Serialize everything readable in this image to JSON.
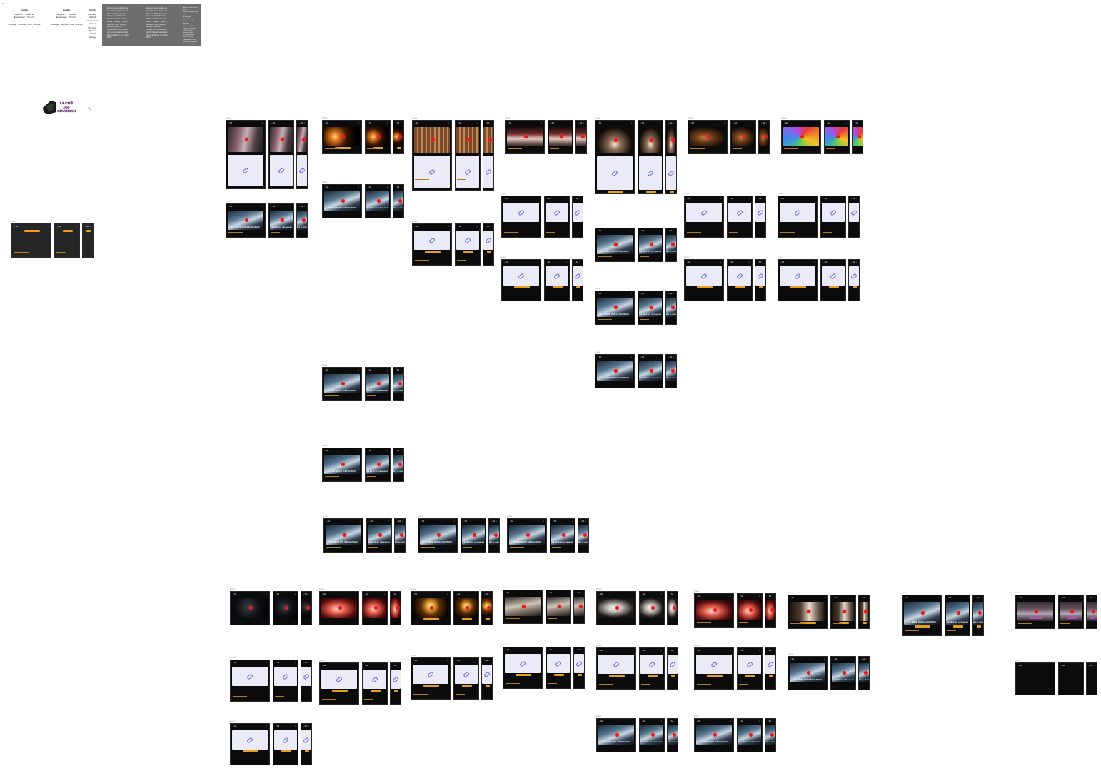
{
  "canvas": {
    "corner_label": "Hi"
  },
  "credits": [
    {
      "title": "Crédits",
      "lines": [
        "Reporter 1 : Hafid E.",
        "Explorateur : Yann C."
      ],
      "footer": "Montage : Maxime \"Pratt\" Grange"
    },
    {
      "title": "Crédits",
      "lines": [
        "Reporter 1 : Hafid E.",
        "Explorateur : Yann C."
      ],
      "footer": "Montage : Maxime \"Pratt\" Grange"
    },
    {
      "title": "Crédits",
      "lines": [
        "Reporter :",
        "Hafid E.",
        "Explorateur",
        ": Yann C."
      ],
      "footer_lines": [
        "Montage :",
        "Maxime",
        "\"Pratt\"",
        "Grange"
      ]
    }
  ],
  "info_panel": {
    "col1": [
      "Escape Game réalisé par",
      "EnanaEscape (Yann C. &",
      "Maxime \"Pratt\" Grange)",
      "Créé par Hafid/Escape",
      "(Maxime \"Pratt\" Grange)",
      "Acteur : Hafid B., Yann C.,",
      "Maxime \"Pratt\" Grange",
      "Escape réalisé en",
      "collaboration avec le site",
      "de l'Anrtenet-Festival lors",
      "de la pandémie, en février",
      "2021 !"
    ],
    "col2": [
      "Escape Game réalisé par",
      "EnanaEscape (Yann C. &",
      "Maxime \"Pratt\" Grange)",
      "Créé par Hafid/Escape",
      "(Maxime \"Pratt\" Grange)",
      "Acteur : Hafid B., Yann C.,",
      "Maxime \"Pratt\" Grange",
      "Escape réalisé en",
      "collaboration avec le site",
      "de l'Anrtenet-Festival lors",
      "de la pandémie, en février",
      "2021 !"
    ],
    "col3": [
      "Escape Game réalisé par",
      "EnanaEscape (Yann C.",
      "& Maxime",
      "\"Pratt\" Grange)",
      "Créé par Hafid/",
      "Escape",
      "Acteur : Hafid B.,",
      "Yann C., Maxime",
      "\"Pratt\" Grange",
      "Escape réalisé",
      "en collaboration",
      "avec le site de",
      "l'Anrtenet-Festival",
      "lors de la pandémie,",
      "en février 2021 !"
    ]
  },
  "logo": {
    "line1": "LA CITÉ",
    "line2": "DES",
    "line3": "GÉVAUDAN",
    "text": "LA CITÉ DES GÉVAUDAN"
  },
  "frame_common": {
    "header": "~Tab",
    "close": "x",
    "label": "Frame",
    "caption": "LA BÊTE DU GÉVAUDAN"
  },
  "colors": {
    "accent": "#e8a01c",
    "pane": "#ebebf8",
    "link": "#6a6ae0",
    "purple": "#b44cc4",
    "red_marker": "#e31b1b"
  },
  "icons": [
    "link-icon",
    "close-icon",
    "red-marker-icon",
    "cursor-icon"
  ]
}
